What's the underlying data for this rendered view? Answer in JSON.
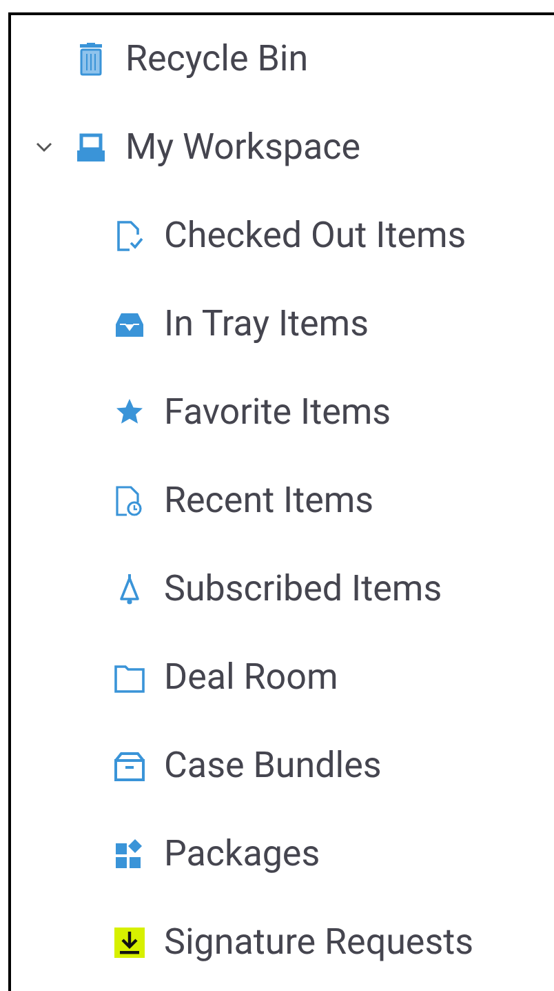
{
  "tree": [
    {
      "label": "Recycle Bin",
      "kind": "trash"
    },
    {
      "label": "My Workspace",
      "kind": "workspace",
      "expanded": true,
      "children": [
        {
          "label": "Checked Out Items",
          "kind": "checkout"
        },
        {
          "label": "In Tray Items",
          "kind": "tray"
        },
        {
          "label": "Favorite Items",
          "kind": "star"
        },
        {
          "label": "Recent Items",
          "kind": "recent"
        },
        {
          "label": "Subscribed Items",
          "kind": "bell"
        },
        {
          "label": "Deal Room",
          "kind": "folder"
        },
        {
          "label": "Case Bundles",
          "kind": "bundle"
        },
        {
          "label": "Packages",
          "kind": "packages"
        },
        {
          "label": "Signature Requests",
          "kind": "signature"
        }
      ]
    }
  ]
}
